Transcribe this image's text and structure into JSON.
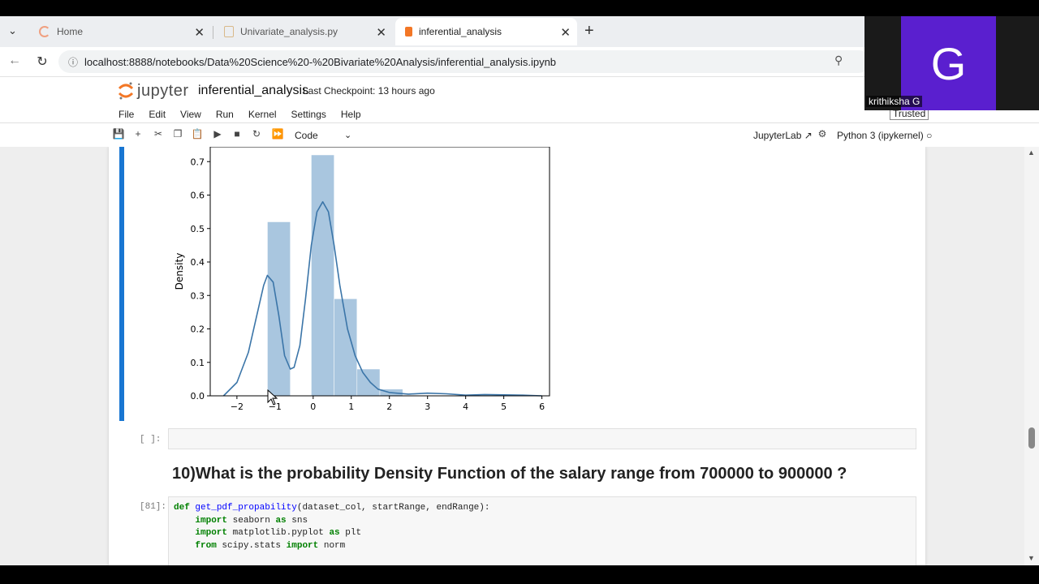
{
  "browser": {
    "tabs": [
      {
        "label": "Home",
        "active": false
      },
      {
        "label": "Univariate_analysis.py",
        "active": false
      },
      {
        "label": "inferential_analysis",
        "active": true
      }
    ],
    "url": "localhost:8888/notebooks/Data%20Science%20-%20Bivariate%20Analysis/inferential_analysis.ipynb"
  },
  "jupyter": {
    "logo_text": "jupyter",
    "notebook_title": "inferential_analysis",
    "checkpoint": "Last Checkpoint: 13 hours ago",
    "menu": [
      "File",
      "Edit",
      "View",
      "Run",
      "Kernel",
      "Settings",
      "Help"
    ],
    "cell_type": "Code",
    "jupyterlab_label": "JupyterLab",
    "kernel_label": "Python 3 (ipykernel)",
    "trusted_label": "Trusted"
  },
  "notebook": {
    "empty_prompt": "[ ]:",
    "heading": "10)What is the probability Density Function of the salary range from 700000 to 900000 ?",
    "code_prompt": "[81]:"
  },
  "webcam": {
    "initial": "G",
    "name": "krithiksha G",
    "color": "#5a1fcf"
  },
  "chart_data": {
    "type": "bar",
    "title": "",
    "xlabel": "",
    "ylabel": "Density",
    "xlim": [
      -2.7,
      6.2
    ],
    "ylim": [
      0,
      0.72
    ],
    "xticks": [
      -2,
      -1,
      0,
      1,
      2,
      3,
      4,
      5,
      6
    ],
    "yticks": [
      0.0,
      0.1,
      0.2,
      0.3,
      0.4,
      0.5,
      0.6,
      0.7
    ],
    "bar_color": "#a9c6df",
    "line_color": "#3b75a8",
    "histogram": [
      {
        "x0": -1.2,
        "x1": -0.6,
        "density": 0.52
      },
      {
        "x0": -0.6,
        "x1": -0.05,
        "density": 0.0
      },
      {
        "x0": -0.05,
        "x1": 0.55,
        "density": 0.72
      },
      {
        "x0": 0.55,
        "x1": 1.15,
        "density": 0.29
      },
      {
        "x0": 1.15,
        "x1": 1.75,
        "density": 0.08
      },
      {
        "x0": 1.75,
        "x1": 2.35,
        "density": 0.02
      }
    ],
    "kde": {
      "x": [
        -2.35,
        -2.0,
        -1.7,
        -1.5,
        -1.3,
        -1.2,
        -1.05,
        -0.9,
        -0.75,
        -0.6,
        -0.5,
        -0.35,
        -0.2,
        -0.05,
        0.1,
        0.25,
        0.4,
        0.55,
        0.7,
        0.9,
        1.1,
        1.3,
        1.5,
        1.7,
        2.0,
        2.5,
        3.0,
        3.5,
        4.0,
        4.5,
        5.0,
        5.5,
        6.0
      ],
      "y": [
        0.0,
        0.04,
        0.13,
        0.23,
        0.33,
        0.36,
        0.34,
        0.24,
        0.12,
        0.08,
        0.085,
        0.15,
        0.29,
        0.45,
        0.55,
        0.58,
        0.55,
        0.45,
        0.33,
        0.2,
        0.12,
        0.07,
        0.04,
        0.02,
        0.01,
        0.005,
        0.008,
        0.006,
        0.002,
        0.004,
        0.003,
        0.002,
        0.0
      ]
    }
  },
  "code_lines": [
    "def get_pdf_propability(dataset_col, startRange, endRange):",
    "    import seaborn as sns",
    "    import matplotlib.pyplot as plt",
    "    from scipy.stats import norm"
  ]
}
